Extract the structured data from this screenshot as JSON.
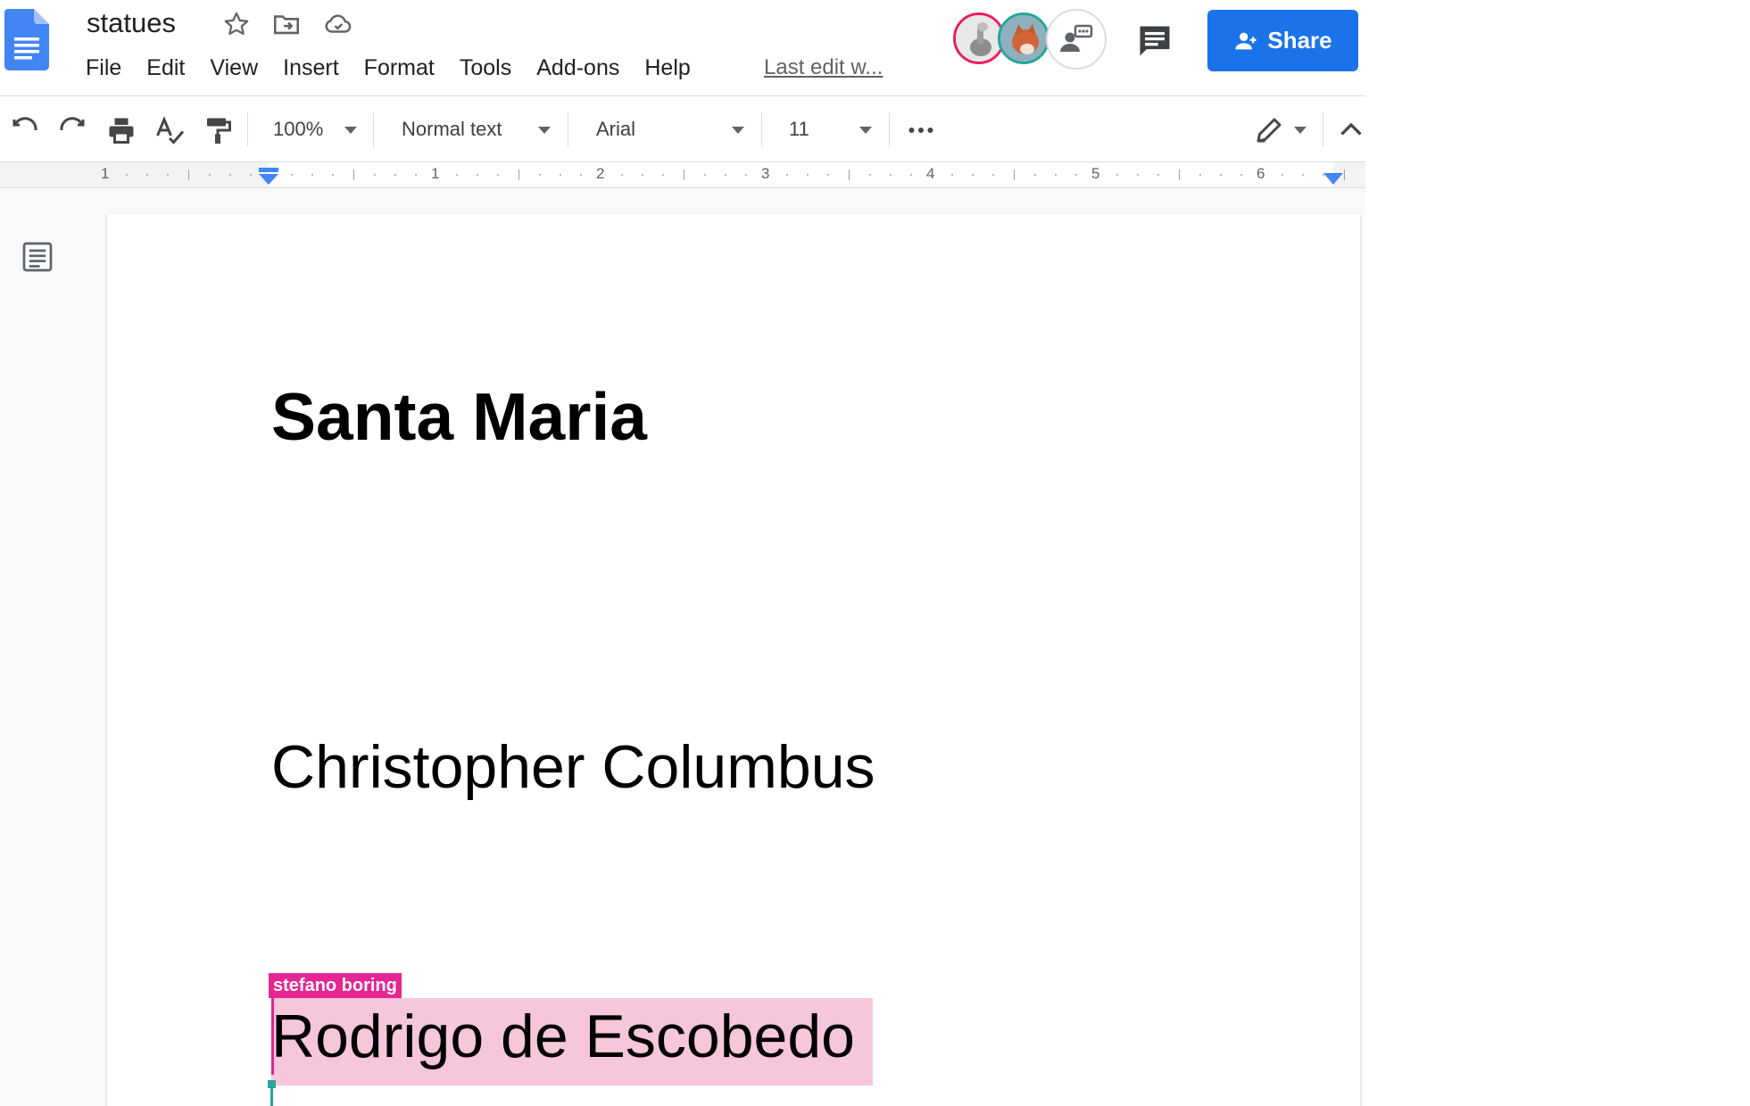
{
  "doc": {
    "title": "statues",
    "last_edit": "Last edit w..."
  },
  "menu": [
    "File",
    "Edit",
    "View",
    "Insert",
    "Format",
    "Tools",
    "Add-ons",
    "Help"
  ],
  "share": {
    "label": "Share"
  },
  "toolbar": {
    "zoom": "100%",
    "style": "Normal text",
    "font": "Arial",
    "size": "11"
  },
  "ruler": {
    "labels": [
      "1",
      "1",
      "2",
      "3",
      "4",
      "5",
      "6"
    ]
  },
  "content": {
    "heading": "Santa Maria",
    "line2": "Christopher Columbus",
    "line3": "Rodrigo de Escobedo",
    "collaborator": "stefano boring"
  },
  "colors": {
    "accent": "#1a73e8",
    "collaborator": "#e52592",
    "highlight": "#f6c6db",
    "self_cursor": "#26a69a"
  }
}
